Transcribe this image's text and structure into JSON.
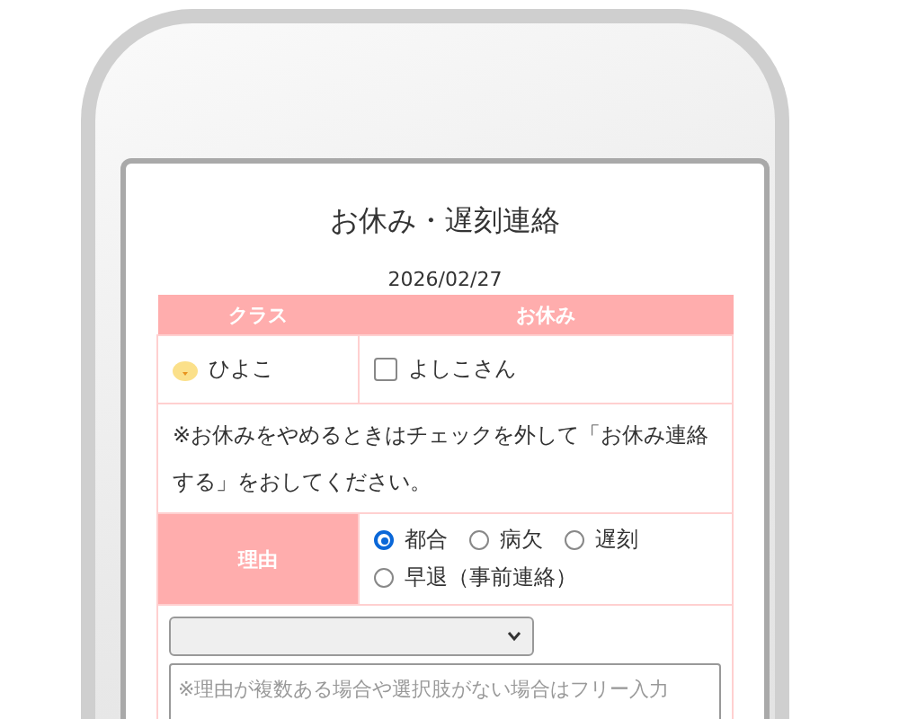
{
  "title": "お休み・遅刻連絡",
  "date": "2026/02/27",
  "table": {
    "columns": [
      "クラス",
      "お休み"
    ],
    "class_name": "ひよこ",
    "student": {
      "name": "よしこさん",
      "checked": false
    },
    "note": "※お休みをやめるときはチェックを外して「お休み連絡する」をおしてください。",
    "reason": {
      "label": "理由",
      "options": [
        {
          "label": "都合",
          "selected": true
        },
        {
          "label": "病欠",
          "selected": false
        },
        {
          "label": "遅刻",
          "selected": false
        },
        {
          "label": "早退（事前連絡）",
          "selected": false
        }
      ]
    },
    "detail": {
      "placeholder": "※理由が複数ある場合や選択肢がない場合はフリー入力"
    }
  }
}
